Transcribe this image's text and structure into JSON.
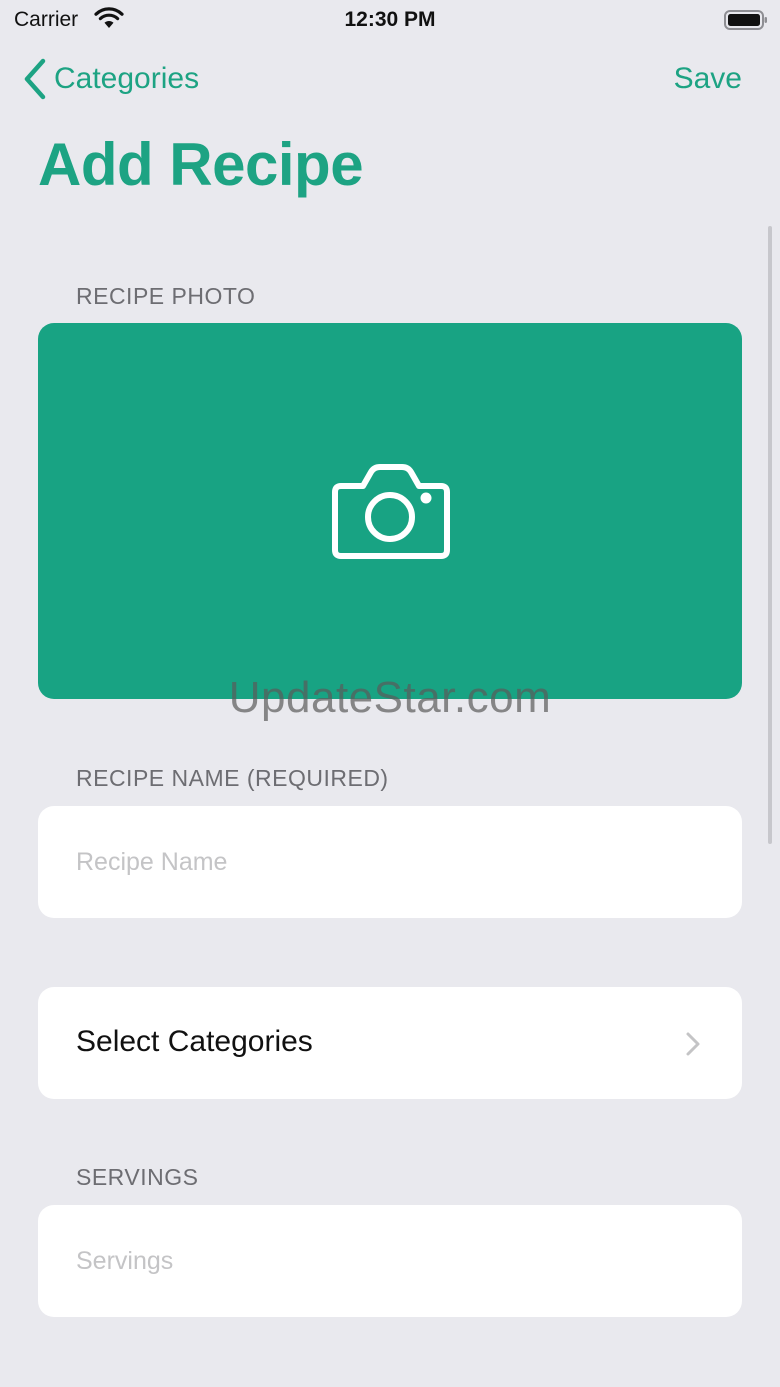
{
  "status_bar": {
    "carrier": "Carrier",
    "time": "12:30 PM",
    "icons": [
      "wifi-icon",
      "battery-icon"
    ]
  },
  "nav": {
    "back_label": "Categories",
    "back_icon": "chevron-left-icon",
    "save_label": "Save",
    "title": "Add Recipe"
  },
  "photo_section": {
    "label": "RECIPE PHOTO",
    "icon": "camera-icon"
  },
  "name_section": {
    "label": "RECIPE NAME (REQUIRED)",
    "placeholder": "Recipe Name",
    "value": ""
  },
  "categories": {
    "label": "Select Categories",
    "icon": "chevron-right-icon"
  },
  "servings_section": {
    "label": "SERVINGS",
    "placeholder": "Servings",
    "value": ""
  },
  "watermark": "UpdateStar.com",
  "colors": {
    "accent": "#1da383",
    "photo_background": "#18a383",
    "page_background": "#e9e9ee",
    "card_background": "#ffffff"
  }
}
